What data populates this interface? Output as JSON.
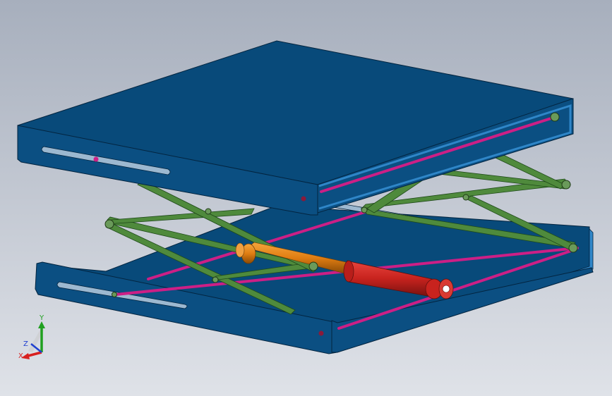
{
  "viewport": {
    "background_top": "#a7afbd",
    "background_bottom": "#dfe2e8"
  },
  "colors": {
    "plate_top": "#084a7a",
    "plate_side": "#0b4f82",
    "plate_edge": "#2f86c8",
    "arm": "#4f8a3c",
    "arm_edge": "#1f4a1a",
    "rod": "#cc1f86",
    "cylinder_body": "#c8231e",
    "cylinder_piston": "#e07d12",
    "slot": "#9cb8d0"
  },
  "triad": {
    "x_label": "X",
    "y_label": "Y",
    "z_label": "Z",
    "x_color": "#d82020",
    "y_color": "#20a020",
    "z_color": "#2040d0"
  }
}
